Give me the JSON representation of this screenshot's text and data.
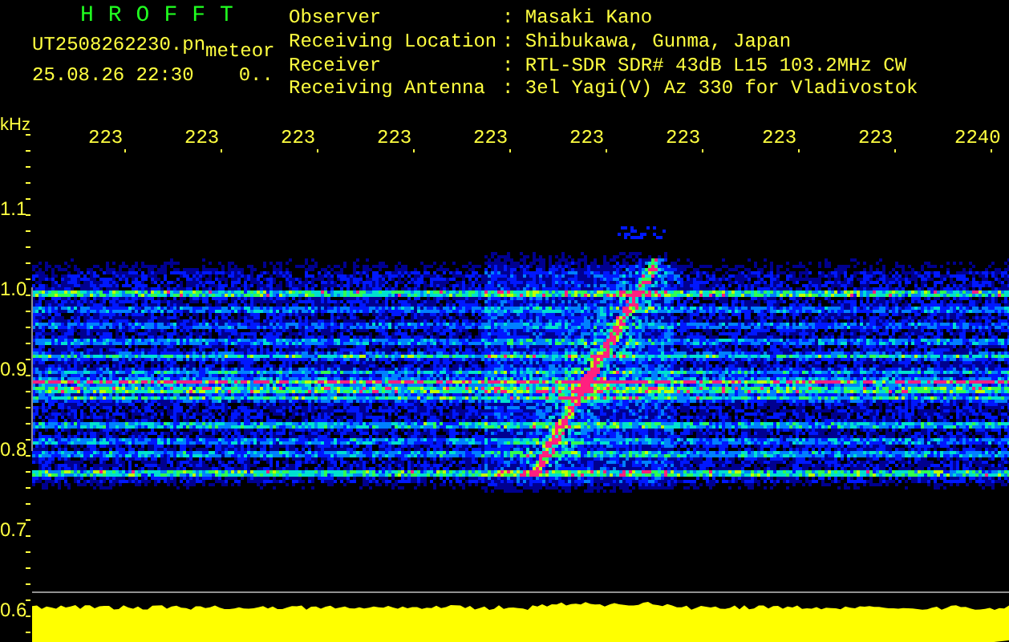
{
  "header": {
    "title": "HROFFT",
    "file_name": "UT2508262230.pn",
    "tag": "meteor",
    "timestamp": "25.08.26 22:30",
    "count": "0..",
    "info": [
      {
        "label": "Observer",
        "value": ": Masaki Kano"
      },
      {
        "label": "Receiving Location",
        "value": ": Shibukawa, Gunma, Japan"
      },
      {
        "label": "Receiver",
        "value": ": RTL-SDR SDR# 43dB L15 103.2MHz CW"
      },
      {
        "label": "Receiving Antenna",
        "value": ": 3el Yagi(V) Az 330 for Vladivostok"
      }
    ]
  },
  "plot": {
    "unit": "kHz",
    "x_labels": [
      "223",
      "223",
      "223",
      "223",
      "223",
      "223",
      "223",
      "223",
      "223",
      "2240"
    ],
    "y_labels": [
      "1.1",
      "1.0",
      "0.9",
      "0.8",
      "0.7",
      "0.6"
    ]
  }
}
